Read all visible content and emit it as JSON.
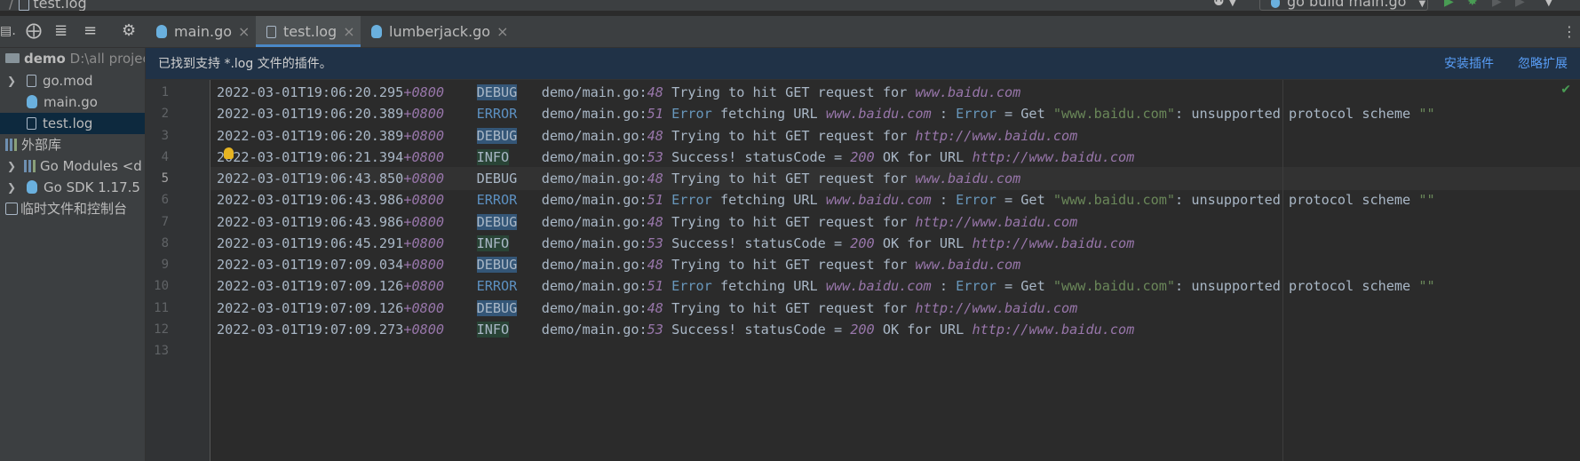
{
  "topbar": {
    "crumb_sep": "/",
    "crumb_file": "test.log",
    "run_config": "go build main.go"
  },
  "sidebar": {
    "items": [
      {
        "name": "demo",
        "path": "D:\\all projec"
      },
      {
        "label": "go.mod"
      },
      {
        "label": "main.go"
      },
      {
        "label": "test.log"
      },
      {
        "label": "外部库"
      },
      {
        "label": "Go Modules <d"
      },
      {
        "label": "Go SDK 1.17.5"
      },
      {
        "label": "临时文件和控制台"
      }
    ]
  },
  "tabs": [
    {
      "label": "main.go",
      "close": "×"
    },
    {
      "label": "test.log",
      "close": "×"
    },
    {
      "label": "lumberjack.go",
      "close": "×"
    }
  ],
  "banner": {
    "text": "已找到支持 *.log 文件的插件。",
    "install": "安装插件",
    "ignore": "忽略扩展"
  },
  "editor": {
    "line_numbers": [
      "1",
      "2",
      "3",
      "4",
      "5",
      "6",
      "7",
      "8",
      "9",
      "10",
      "11",
      "12",
      "13"
    ],
    "lines": [
      {
        "ts": "2022-03-01T19:06:20.295",
        "tz": "+0800",
        "level": "DEBUG",
        "src": "demo/main.go:",
        "lineno": "48",
        "msg": "Trying to hit GET request for ",
        "url": "www.baidu.com"
      },
      {
        "ts": "2022-03-01T19:06:20.389",
        "tz": "+0800",
        "level": "ERROR",
        "src": "demo/main.go:",
        "lineno": "51",
        "err1": "Error",
        "msg": " fetching URL ",
        "url": "www.baidu.com",
        "sep": " : ",
        "err2": "Error",
        "eq": " = Get ",
        "quoted": "\"www.baidu.com\"",
        "tail": ": unsupported protocol scheme ",
        "empty": "\"\""
      },
      {
        "ts": "2022-03-01T19:06:20.389",
        "tz": "+0800",
        "level": "DEBUG",
        "src": "demo/main.go:",
        "lineno": "48",
        "msg": "Trying to hit GET request for ",
        "url": "http://www.baidu.com"
      },
      {
        "ts": "2022-03-01T19:06:21.394",
        "tz": "+0800",
        "level": "INFO",
        "src": "demo/main.go:",
        "lineno": "53",
        "msg": "Success! statusCode = ",
        "code": "200",
        "msg2": " OK for URL ",
        "url": "http://www.baidu.com"
      },
      {
        "ts": "2022-03-01T19:06:43.850",
        "tz": "+0800",
        "level": "DEBUG",
        "src": "demo/main.go:",
        "lineno": "48",
        "msg": "Trying to hit GET request for ",
        "url": "www.baidu.com"
      },
      {
        "ts": "2022-03-01T19:06:43.986",
        "tz": "+0800",
        "level": "ERROR",
        "src": "demo/main.go:",
        "lineno": "51",
        "err1": "Error",
        "msg": " fetching URL ",
        "url": "www.baidu.com",
        "sep": " : ",
        "err2": "Error",
        "eq": " = Get ",
        "quoted": "\"www.baidu.com\"",
        "tail": ": unsupported protocol scheme ",
        "empty": "\"\""
      },
      {
        "ts": "2022-03-01T19:06:43.986",
        "tz": "+0800",
        "level": "DEBUG",
        "src": "demo/main.go:",
        "lineno": "48",
        "msg": "Trying to hit GET request for ",
        "url": "http://www.baidu.com"
      },
      {
        "ts": "2022-03-01T19:06:45.291",
        "tz": "+0800",
        "level": "INFO",
        "src": "demo/main.go:",
        "lineno": "53",
        "msg": "Success! statusCode = ",
        "code": "200",
        "msg2": " OK for URL ",
        "url": "http://www.baidu.com"
      },
      {
        "ts": "2022-03-01T19:07:09.034",
        "tz": "+0800",
        "level": "DEBUG",
        "src": "demo/main.go:",
        "lineno": "48",
        "msg": "Trying to hit GET request for ",
        "url": "www.baidu.com"
      },
      {
        "ts": "2022-03-01T19:07:09.126",
        "tz": "+0800",
        "level": "ERROR",
        "src": "demo/main.go:",
        "lineno": "51",
        "err1": "Error",
        "msg": " fetching URL ",
        "url": "www.baidu.com",
        "sep": " : ",
        "err2": "Error",
        "eq": " = Get ",
        "quoted": "\"www.baidu.com\"",
        "tail": ": unsupported protocol scheme ",
        "empty": "\"\""
      },
      {
        "ts": "2022-03-01T19:07:09.126",
        "tz": "+0800",
        "level": "DEBUG",
        "src": "demo/main.go:",
        "lineno": "48",
        "msg": "Trying to hit GET request for ",
        "url": "http://www.baidu.com"
      },
      {
        "ts": "2022-03-01T19:07:09.273",
        "tz": "+0800",
        "level": "INFO",
        "src": "demo/main.go:",
        "lineno": "53",
        "msg": "Success! statusCode = ",
        "code": "200",
        "msg2": " OK for URL ",
        "url": "http://www.baidu.com"
      }
    ]
  },
  "colors": {
    "accent": "#4a88c7",
    "debug_bg": "#345677",
    "info_bg": "#294436",
    "error_fg": "#5c90c1",
    "link": "#589df6"
  }
}
